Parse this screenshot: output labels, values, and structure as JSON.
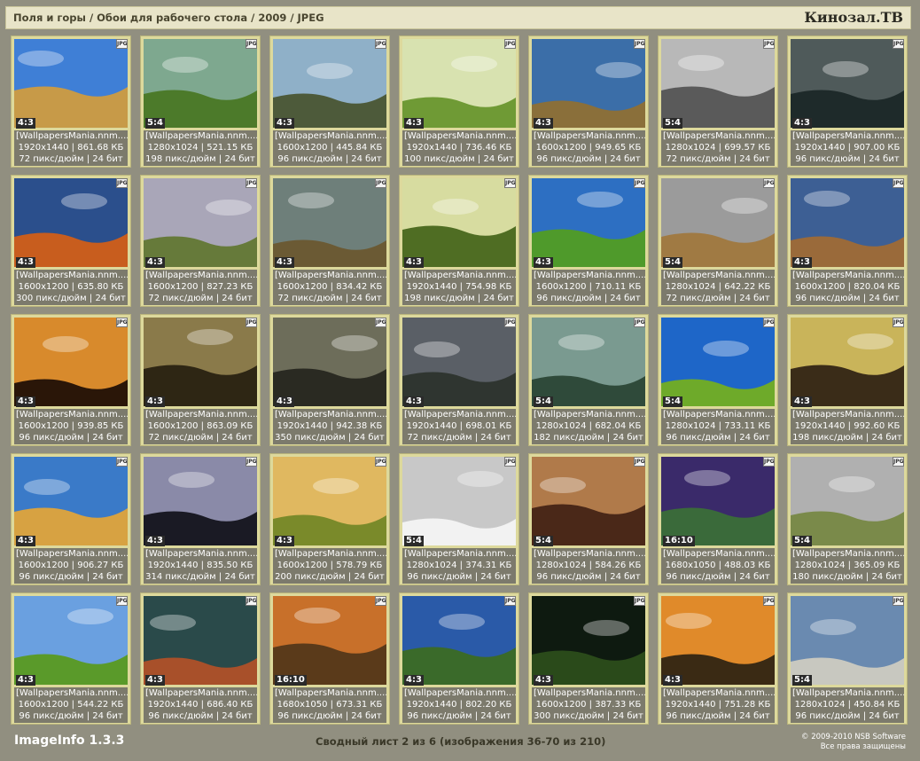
{
  "header": {
    "breadcrumb": "Поля и горы / Обои для рабочего стола / 2009 / JPEG",
    "brand": "Кинозал.ТВ"
  },
  "badge": "JPG",
  "footer": {
    "app_name": "ImageInfo 1.3.3",
    "page_info": "Сводный лист 2 из 6 (изображения 36-70 из 210)",
    "copyright": "© 2009-2010 NSB Software",
    "rights": "Все права защищены"
  },
  "cards": [
    {
      "name": "[WallpapersMania.nnm....",
      "ratio": "4:3",
      "res": "1920x1440",
      "size": "861.68 КБ",
      "dpi": "72 пикс/дюйм | 24 бит",
      "sky": "#3f7fd6",
      "ground": "#c79a48",
      "thumb": "hay-bale-field"
    },
    {
      "name": "[WallpapersMania.nnm....",
      "ratio": "5:4",
      "res": "1280x1024",
      "size": "521.15 КБ",
      "dpi": "198 пикс/дюйм | 24 бит",
      "sky": "#7ea88f",
      "ground": "#4c7a2a",
      "thumb": "green-valley"
    },
    {
      "name": "[WallpapersMania.nnm....",
      "ratio": "4:3",
      "res": "1600x1200",
      "size": "445.84 КБ",
      "dpi": "96 пикс/дюйм | 24 бит",
      "sky": "#8fb0c8",
      "ground": "#4d5a3a",
      "thumb": "mountain-lake"
    },
    {
      "name": "[WallpapersMania.nnm....",
      "ratio": "4:3",
      "res": "1920x1440",
      "size": "736.46 КБ",
      "dpi": "100 пикс/дюйм | 24 бит",
      "sky": "#d8e2b0",
      "ground": "#6f9a35",
      "thumb": "green-meadow"
    },
    {
      "name": "[WallpapersMania.nnm....",
      "ratio": "4:3",
      "res": "1600x1200",
      "size": "949.65 КБ",
      "dpi": "96 пикс/дюйм | 24 бит",
      "sky": "#3b6ea8",
      "ground": "#8a6f3a",
      "thumb": "wooden-path"
    },
    {
      "name": "[WallpapersMania.nnm....",
      "ratio": "5:4",
      "res": "1280x1024",
      "size": "699.57 КБ",
      "dpi": "72 пикс/дюйм | 24 бит",
      "sky": "#b8b8b8",
      "ground": "#5a5a5a",
      "thumb": "grey-trees"
    },
    {
      "name": "[WallpapersMania.nnm....",
      "ratio": "4:3",
      "res": "1920x1440",
      "size": "907.00 КБ",
      "dpi": "96 пикс/дюйм | 24 бит",
      "sky": "#4f5a5a",
      "ground": "#1e2a2a",
      "thumb": "dark-road"
    },
    {
      "name": "[WallpapersMania.nnm....",
      "ratio": "4:3",
      "res": "1600x1200",
      "size": "635.80 КБ",
      "dpi": "300 пикс/дюйм | 24 бит",
      "sky": "#2b4f8c",
      "ground": "#c85d1e",
      "thumb": "sunset-field"
    },
    {
      "name": "[WallpapersMania.nnm....",
      "ratio": "4:3",
      "res": "1600x1200",
      "size": "827.23 КБ",
      "dpi": "72 пикс/дюйм | 24 бит",
      "sky": "#a9a6b8",
      "ground": "#667a3a",
      "thumb": "fantasy-cliffs"
    },
    {
      "name": "[WallpapersMania.nnm....",
      "ratio": "4:3",
      "res": "1600x1200",
      "size": "834.42 КБ",
      "dpi": "72 пикс/дюйм | 24 бит",
      "sky": "#6e7f7a",
      "ground": "#6b5a34",
      "thumb": "cloudy-hills"
    },
    {
      "name": "[WallpapersMania.nnm....",
      "ratio": "4:3",
      "res": "1920x1440",
      "size": "754.98 КБ",
      "dpi": "198 пикс/дюйм | 24 бит",
      "sky": "#d7dca0",
      "ground": "#4f6d23",
      "thumb": "lone-tree-hill"
    },
    {
      "name": "[WallpapersMania.nnm....",
      "ratio": "4:3",
      "res": "1600x1200",
      "size": "710.11 КБ",
      "dpi": "96 пикс/дюйм | 24 бит",
      "sky": "#2d6fc2",
      "ground": "#4f9a2b",
      "thumb": "green-field-trees"
    },
    {
      "name": "[WallpapersMania.nnm....",
      "ratio": "5:4",
      "res": "1280x1024",
      "size": "642.22 КБ",
      "dpi": "72 пикс/дюйм | 24 бит",
      "sky": "#9b9b9b",
      "ground": "#a07a43",
      "thumb": "brown-field"
    },
    {
      "name": "[WallpapersMania.nnm....",
      "ratio": "4:3",
      "res": "1600x1200",
      "size": "820.04 КБ",
      "dpi": "96 пикс/дюйм | 24 бит",
      "sky": "#3d5f94",
      "ground": "#9a6a3a",
      "thumb": "autumn-plain"
    },
    {
      "name": "[WallpapersMania.nnm....",
      "ratio": "4:3",
      "res": "1600x1200",
      "size": "939.85 КБ",
      "dpi": "96 пикс/дюйм | 24 бит",
      "sky": "#d88a2c",
      "ground": "#2a1608",
      "thumb": "tree-silhouette"
    },
    {
      "name": "[WallpapersMania.nnm....",
      "ratio": "4:3",
      "res": "1600x1200",
      "size": "863.09 КБ",
      "dpi": "72 пикс/дюйм | 24 бит",
      "sky": "#8a7a4a",
      "ground": "#2e2614",
      "thumb": "sunset-trees"
    },
    {
      "name": "[WallpapersMania.nnm....",
      "ratio": "4:3",
      "res": "1920x1440",
      "size": "942.38 КБ",
      "dpi": "350 пикс/дюйм | 24 бит",
      "sky": "#6d6d5a",
      "ground": "#2a2a22",
      "thumb": "dark-meadow"
    },
    {
      "name": "[WallpapersMania.nnm....",
      "ratio": "4:3",
      "res": "1920x1440",
      "size": "698.01 КБ",
      "dpi": "72 пикс/дюйм | 24 бит",
      "sky": "#5a5f66",
      "ground": "#2f3530",
      "thumb": "storm-clouds"
    },
    {
      "name": "[WallpapersMania.nnm....",
      "ratio": "5:4",
      "res": "1280x1024",
      "size": "682.04 КБ",
      "dpi": "182 пикс/дюйм | 24 бит",
      "sky": "#7a9a90",
      "ground": "#2f4a3a",
      "thumb": "waterfall-cliffs"
    },
    {
      "name": "[WallpapersMania.nnm....",
      "ratio": "5:4",
      "res": "1280x1024",
      "size": "733.11 КБ",
      "dpi": "96 пикс/дюйм | 24 бит",
      "sky": "#1e66c8",
      "ground": "#6eaa2a",
      "thumb": "swirl-sky-field"
    },
    {
      "name": "[WallpapersMania.nnm....",
      "ratio": "4:3",
      "res": "1920x1440",
      "size": "992.60 КБ",
      "dpi": "198 пикс/дюйм | 24 бит",
      "sky": "#c9b45a",
      "ground": "#3a2c18",
      "thumb": "dusk-tree"
    },
    {
      "name": "[WallpapersMania.nnm....",
      "ratio": "4:3",
      "res": "1600x1200",
      "size": "906.27 КБ",
      "dpi": "96 пикс/дюйм | 24 бит",
      "sky": "#3a7ac8",
      "ground": "#d7a242",
      "thumb": "sand-dunes"
    },
    {
      "name": "[WallpapersMania.nnm....",
      "ratio": "4:3",
      "res": "1920x1440",
      "size": "835.50 КБ",
      "dpi": "314 пикс/дюйм | 24 бит",
      "sky": "#8a8aa8",
      "ground": "#1a1a24",
      "thumb": "night-trees"
    },
    {
      "name": "[WallpapersMania.nnm....",
      "ratio": "4:3",
      "res": "1600x1200",
      "size": "578.79 КБ",
      "dpi": "200 пикс/дюйм | 24 бит",
      "sky": "#e0b860",
      "ground": "#7a8a2a",
      "thumb": "wheat-field"
    },
    {
      "name": "[WallpapersMania.nnm....",
      "ratio": "5:4",
      "res": "1280x1024",
      "size": "374.31 КБ",
      "dpi": "96 пикс/дюйм | 24 бит",
      "sky": "#c8c8c8",
      "ground": "#f2f2f2",
      "thumb": "snowy-mountains"
    },
    {
      "name": "[WallpapersMania.nnm....",
      "ratio": "5:4",
      "res": "1280x1024",
      "size": "584.26 КБ",
      "dpi": "96 пикс/дюйм | 24 бит",
      "sky": "#b07a4a",
      "ground": "#4a2818",
      "thumb": "volcano"
    },
    {
      "name": "[WallpapersMania.nnm....",
      "ratio": "16:10",
      "res": "1680x1050",
      "size": "488.03 КБ",
      "dpi": "96 пикс/дюйм | 24 бит",
      "sky": "#3a2a6a",
      "ground": "#3a6a3a",
      "thumb": "night-rocks"
    },
    {
      "name": "[WallpapersMania.nnm....",
      "ratio": "5:4",
      "res": "1280x1024",
      "size": "365.09 КБ",
      "dpi": "180 пикс/дюйм | 24 бит",
      "sky": "#b0b0b0",
      "ground": "#7a8a4a",
      "thumb": "foggy-tree"
    },
    {
      "name": "[WallpapersMania.nnm....",
      "ratio": "4:3",
      "res": "1600x1200",
      "size": "544.22 КБ",
      "dpi": "96 пикс/дюйм | 24 бит",
      "sky": "#6aa0e0",
      "ground": "#5a9a2a",
      "thumb": "poppy-field"
    },
    {
      "name": "[WallpapersMania.nnm....",
      "ratio": "4:3",
      "res": "1920x1440",
      "size": "686.40 КБ",
      "dpi": "96 пикс/дюйм | 24 бит",
      "sky": "#2a4a4a",
      "ground": "#a8502a",
      "thumb": "red-hills"
    },
    {
      "name": "[WallpapersMania.nnm....",
      "ratio": "16:10",
      "res": "1680x1050",
      "size": "673.31 КБ",
      "dpi": "96 пикс/дюйм | 24 бит",
      "sky": "#c8702a",
      "ground": "#5a3a1a",
      "thumb": "canyon-sunset"
    },
    {
      "name": "[WallpapersMania.nnm....",
      "ratio": "4:3",
      "res": "1920x1440",
      "size": "802.20 КБ",
      "dpi": "96 пикс/дюйм | 24 бит",
      "sky": "#2a5aa8",
      "ground": "#3a6a2a",
      "thumb": "tree-under-sky"
    },
    {
      "name": "[WallpapersMania.nnm....",
      "ratio": "4:3",
      "res": "1600x1200",
      "size": "387.33 КБ",
      "dpi": "300 пикс/дюйм | 24 бит",
      "sky": "#0e1a10",
      "ground": "#2a4a1a",
      "thumb": "forest-glade"
    },
    {
      "name": "[WallpapersMania.nnm....",
      "ratio": "4:3",
      "res": "1920x1440",
      "size": "751.28 КБ",
      "dpi": "96 пикс/дюйм | 24 бит",
      "sky": "#e08a2a",
      "ground": "#3a2a14",
      "thumb": "sunset-child"
    },
    {
      "name": "[WallpapersMania.nnm....",
      "ratio": "5:4",
      "res": "1280x1024",
      "size": "450.84 КБ",
      "dpi": "96 пикс/дюйм | 24 бит",
      "sky": "#6a8ab0",
      "ground": "#c8c8c0",
      "thumb": "frosty-field-bale"
    }
  ]
}
